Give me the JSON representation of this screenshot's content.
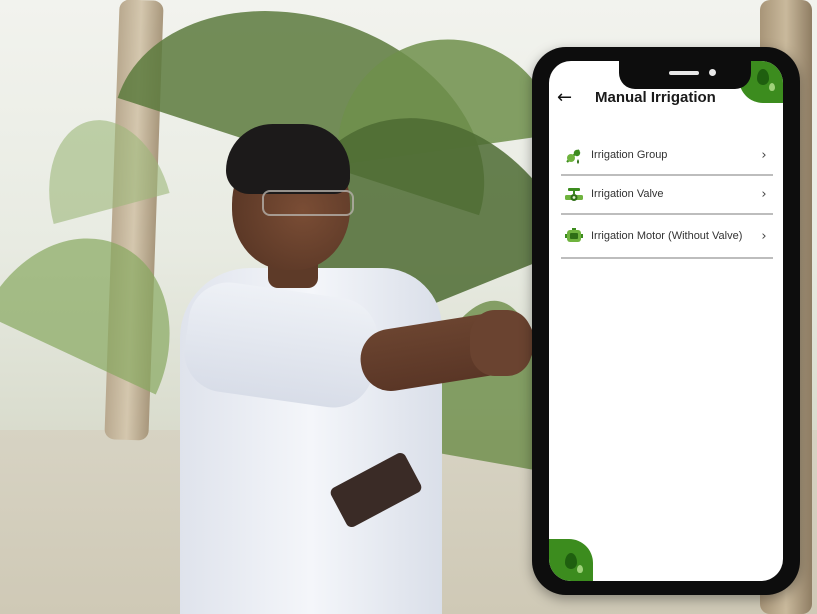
{
  "app": {
    "title": "Manual Irrigation",
    "back_icon": "arrow-left-icon"
  },
  "menu": {
    "items": [
      {
        "label": "Irrigation Group",
        "icon": "irrigation-group-icon"
      },
      {
        "label": "Irrigation Valve",
        "icon": "irrigation-valve-icon"
      },
      {
        "label": "Irrigation Motor (Without Valve)",
        "icon": "irrigation-motor-icon"
      }
    ],
    "chevron": "›"
  },
  "colors": {
    "accent": "#3c8c1e",
    "accent_dark": "#1f5f0f",
    "phone_frame": "#0d0d0d"
  }
}
